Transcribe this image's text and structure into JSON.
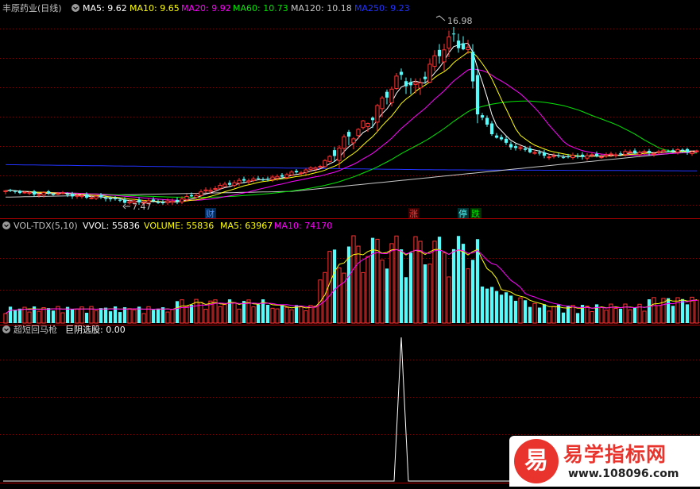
{
  "colors": {
    "up": "#ff3232",
    "down": "#54fcfc",
    "ma5": "#ffffff",
    "ma10": "#ffff00",
    "ma20": "#ff00ff",
    "ma60": "#00e600",
    "ma120": "#c8c8c8",
    "ma250": "#2233ff",
    "axis": "#b00000",
    "grid": "#8a0000"
  },
  "price_panel": {
    "title": "丰原药业(日线)",
    "legend": [
      {
        "name": "MA5",
        "text": "MA5: 9.62",
        "color": "#ffffff"
      },
      {
        "name": "MA10",
        "text": "MA10: 9.65",
        "color": "#ffff00"
      },
      {
        "name": "MA20",
        "text": "MA20: 9.92",
        "color": "#ff00ff"
      },
      {
        "name": "MA60",
        "text": "MA60: 10.73",
        "color": "#00e600"
      },
      {
        "name": "MA120",
        "text": "MA120: 10.18",
        "color": "#c8c8c8"
      },
      {
        "name": "MA250",
        "text": "MA250: 9.23",
        "color": "#2233ff"
      }
    ],
    "high_label": "16.98",
    "low_label": "7.47",
    "markers": [
      {
        "text": "财",
        "index": 42,
        "color": "#4f8fff"
      },
      {
        "text": "涨",
        "index": 87,
        "color": "#ff4444"
      },
      {
        "text": "停",
        "index": 97,
        "color": "#54fcfc"
      },
      {
        "text": "跌",
        "index": 100,
        "color": "#00e600"
      }
    ]
  },
  "volume_panel": {
    "title": "VOL-TDX(5,10)",
    "legend": [
      {
        "name": "VVOL",
        "text": "VVOL: 55836",
        "color": "#ffffff"
      },
      {
        "name": "VOLUME",
        "text": "VOLUME: 55836",
        "color": "#ffff00"
      },
      {
        "name": "MA5",
        "text": "MA5: 63967",
        "color": "#ffff00"
      },
      {
        "name": "MA10",
        "text": "MA10: 74170",
        "color": "#ff00ff"
      }
    ]
  },
  "indicator_panel": {
    "title": "超短回马枪",
    "legend": [
      {
        "name": "巨阴选股",
        "text": "巨阴选股: 0.00",
        "color": "#ffffff"
      }
    ]
  },
  "watermark": {
    "logo": "易",
    "title": "易学指标网",
    "url": "www.108096.com"
  },
  "chart_data": {
    "type": "candlestick",
    "count": 146,
    "highlight": {
      "high": 16.98,
      "low": 7.47
    },
    "signal": {
      "index": 83,
      "value": 1,
      "last_value": 0.0
    }
  }
}
